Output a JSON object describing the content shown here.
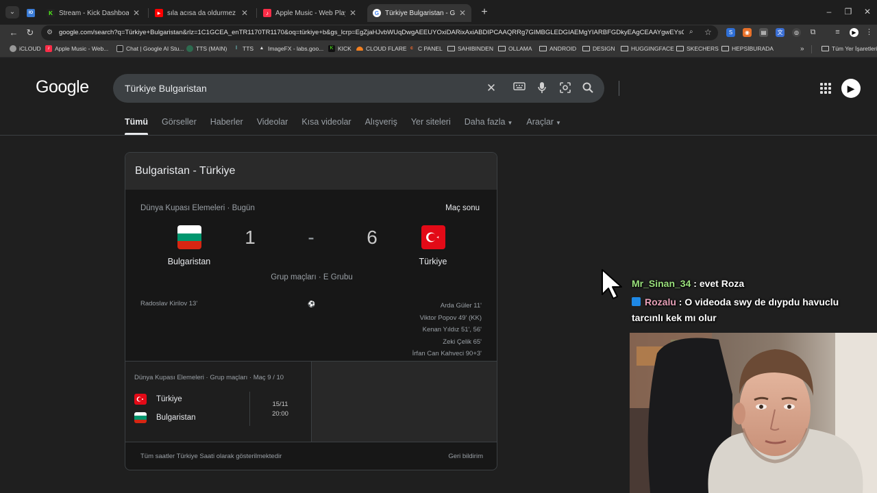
{
  "browser": {
    "tabs": [
      {
        "title": "",
        "icon": "tab-icon-io"
      },
      {
        "title": "Stream - Kick Dashboard",
        "icon": "kick-icon"
      },
      {
        "title": "sıla acısa da oldurmez - YouTub",
        "icon": "youtube-icon"
      },
      {
        "title": "Apple Music - Web Player",
        "icon": "apple-music-icon"
      },
      {
        "title": "Türkiye Bulgaristan - Google'da",
        "icon": "google-icon"
      }
    ],
    "active_tab": 4,
    "url": "google.com/search?q=Türkiye+Bulgaristan&rlz=1C1GCEA_enTR1170TR1170&oq=türkiye+b&gs_lcrp=EgZjaHJvbWUqDwgAEEUYOxiDARixAxiABDIPCAAQRRg7GIMBGLEDGIAEMgYIARBFGDkyEAgCEAAYgwEYsQMYgAQYig...",
    "bookmarks": [
      {
        "label": "iCLOUD",
        "icon": "icloud-icon"
      },
      {
        "label": "Apple Music - Web...",
        "icon": "apple-music-icon"
      },
      {
        "label": "Chat | Google AI Stu...",
        "icon": "ai-studio-icon"
      },
      {
        "label": "TTS (MAIN)",
        "icon": "tts-icon"
      },
      {
        "label": "TTS",
        "icon": "tts-icon"
      },
      {
        "label": "ImageFX - labs.goo...",
        "icon": "imagefx-icon"
      },
      {
        "label": "KICK",
        "icon": "kick-icon"
      },
      {
        "label": "CLOUD FLARE",
        "icon": "cloudflare-icon"
      },
      {
        "label": "C PANEL",
        "icon": "cpanel-icon"
      },
      {
        "label": "SAHIBINDEN",
        "icon": "folder-icon"
      },
      {
        "label": "OLLAMA",
        "icon": "folder-icon"
      },
      {
        "label": "ANDROID",
        "icon": "folder-icon"
      },
      {
        "label": "DESIGN",
        "icon": "folder-icon"
      },
      {
        "label": "HUGGINGFACE",
        "icon": "folder-icon"
      },
      {
        "label": "SKECHERS",
        "icon": "folder-icon"
      },
      {
        "label": "HEPSİBURADA",
        "icon": "folder-icon"
      }
    ],
    "all_bookmarks": "Tüm Yer İşaretleri"
  },
  "google": {
    "logo": "Google",
    "query": "Türkiye Bulgaristan",
    "nav_tabs": [
      {
        "label": "Tümü",
        "active": true
      },
      {
        "label": "Görseller"
      },
      {
        "label": "Haberler"
      },
      {
        "label": "Videolar"
      },
      {
        "label": "Kısa videolar"
      },
      {
        "label": "Alışveriş"
      },
      {
        "label": "Yer siteleri"
      },
      {
        "label": "Daha fazla",
        "dropdown": true
      },
      {
        "label": "Araçlar",
        "dropdown": true
      }
    ]
  },
  "match": {
    "title": "Bulgaristan - Türkiye",
    "competition": "Dünya Kupası Elemeleri · Bugün",
    "status": "Maç sonu",
    "home": {
      "name": "Bulgaristan",
      "score": "1",
      "flag_colors": [
        "#ffffff",
        "#00966e",
        "#d62612"
      ]
    },
    "separator": "-",
    "away": {
      "name": "Türkiye",
      "score": "6",
      "flag_color": "#e30a17"
    },
    "stage": "Grup maçları · E Grubu",
    "home_scorers": [
      "Radoslav Kirilov 13'"
    ],
    "away_scorers": [
      "Arda Güler 11'",
      "Viktor Popov 49' (KK)",
      "Kenan Yıldız 51', 56'",
      "Zeki Çelik 65'",
      "İrfan Can Kahveci 90+3'"
    ],
    "next": {
      "meta": "Dünya Kupası Elemeleri · Grup maçları · Maç 9 / 10",
      "team1": "Türkiye",
      "team2": "Bulgaristan",
      "date": "15/11",
      "time": "20:00"
    },
    "footnote": "Tüm saatler Türkiye Saati olarak gösterilmektedir",
    "feedback": "Geri bildirim"
  },
  "chat": [
    {
      "user": "Mr_Sinan_34",
      "text": " : evet Roza"
    },
    {
      "user": "Rozalu",
      "text": " : O videoda swy de dıypdu havuclu tarcınlı kek mı olur"
    }
  ]
}
